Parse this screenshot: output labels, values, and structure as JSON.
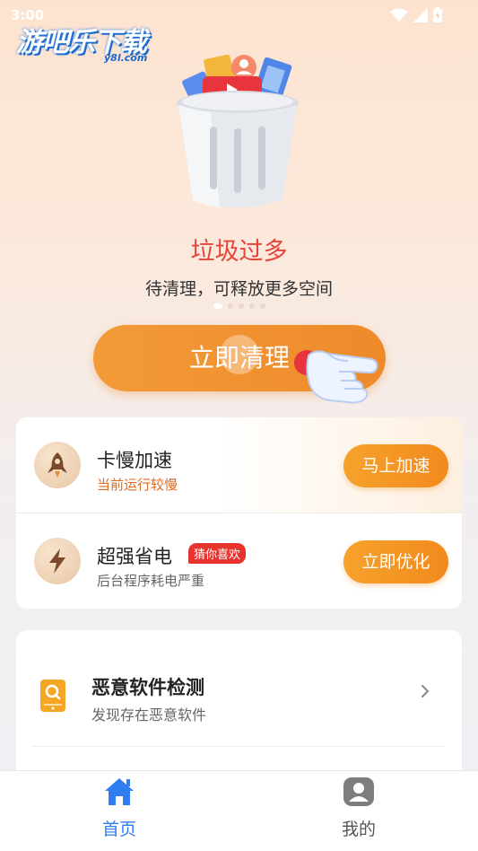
{
  "status_bar": {
    "time": "3:00"
  },
  "watermark": {
    "text": "游吧乐下载",
    "sub": "y8l.com"
  },
  "hero": {
    "headline": "垃圾过多",
    "subline": "待清理，可释放更多空间",
    "clean_button_label": "立即清理",
    "carousel_pages": 5,
    "carousel_active": 1
  },
  "features": [
    {
      "title": "卡慢加速",
      "subtitle": "当前运行较慢",
      "button": "马上加速",
      "icon": "rocket-icon"
    },
    {
      "title": "超强省电",
      "badge": "猜你喜欢",
      "subtitle": "后台程序耗电严重",
      "button": "立即优化",
      "icon": "lightning-icon"
    }
  ],
  "tools": [
    {
      "title": "恶意软件检测",
      "subtitle": "发现存在恶意软件",
      "icon": "phone-scan-icon"
    }
  ],
  "bottom_nav": [
    {
      "label": "首页",
      "icon": "home-icon",
      "active": true
    },
    {
      "label": "我的",
      "icon": "profile-icon",
      "active": false
    }
  ],
  "colors": {
    "accent_orange": "#ee8a2a",
    "headline_red": "#e8433a",
    "nav_active_blue": "#2f7df0",
    "badge_red": "#e8322e"
  }
}
